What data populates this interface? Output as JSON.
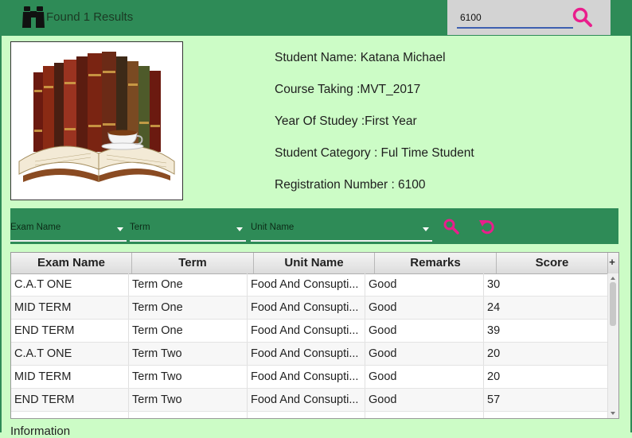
{
  "header": {
    "results_text": "Found 1 Results",
    "search_value": "6100",
    "icons": {
      "binoculars": "binoculars-icon",
      "search": "search-icon"
    }
  },
  "student": {
    "name_line": "Student Name: Katana Michael",
    "course_line": "Course Taking :MVT_2017",
    "year_line": "Year Of Studey :First Year",
    "category_line": "Student Category : Ful Time Student",
    "reg_line": "Registration Number : 6100"
  },
  "filters": {
    "exam_name": "Exam Name",
    "term": "Term",
    "unit_name": "Unit Name",
    "icons": {
      "search": "search-icon",
      "reset": "reset-icon"
    }
  },
  "table": {
    "columns": [
      "Exam Name",
      "Term",
      "Unit Name",
      "Remarks",
      "Score"
    ],
    "rows": [
      [
        "C.A.T ONE",
        "Term One",
        "Food And Consupti...",
        "Good",
        "30"
      ],
      [
        "MID TERM",
        "Term One",
        "Food And Consupti...",
        "Good",
        "24"
      ],
      [
        "END TERM",
        "Term One",
        "Food And Consupti...",
        "Good",
        "39"
      ],
      [
        "C.A.T ONE",
        "Term Two",
        "Food And Consupti...",
        "Good",
        "20"
      ],
      [
        "MID TERM",
        "Term Two",
        "Food And Consupti...",
        "Good",
        "20"
      ],
      [
        "END TERM",
        "Term Two",
        "Food And Consupti...",
        "Good",
        "57"
      ]
    ]
  },
  "footer": {
    "information_label": "Information"
  },
  "colors": {
    "header_green": "#2e8b57",
    "background": "#ccfcc6",
    "accent_pink": "#e91e8c"
  }
}
